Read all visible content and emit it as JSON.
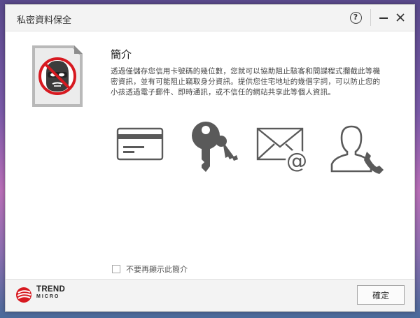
{
  "window": {
    "title": "私密資料保全"
  },
  "titlebar": {
    "help_icon": "question-circle-icon",
    "help_glyph": "?",
    "minimize_icon": "minimize-icon",
    "close_icon": "close-icon"
  },
  "intro": {
    "heading": "簡介",
    "description": "透過僅儲存您信用卡號碼的幾位數，您就可以協助阻止駭客和間諜程式攔截此等機密資訊，並有可能阻止竊取身分資訊。提供您住宅地址的幾個字詞，可以防止您的小孩透過電子郵件、即時通訊，或不信任的網站共享此等個人資訊。"
  },
  "features": [
    {
      "icon": "credit-card-icon"
    },
    {
      "icon": "keys-icon"
    },
    {
      "icon": "email-at-icon"
    },
    {
      "icon": "contact-phone-icon"
    }
  ],
  "checkbox": {
    "label": "不要再顯示此簡介",
    "checked": false
  },
  "footer": {
    "brand_line1": "TREND",
    "brand_line2": "MICRO",
    "brand_color": "#d71920",
    "ok_label": "確定"
  }
}
